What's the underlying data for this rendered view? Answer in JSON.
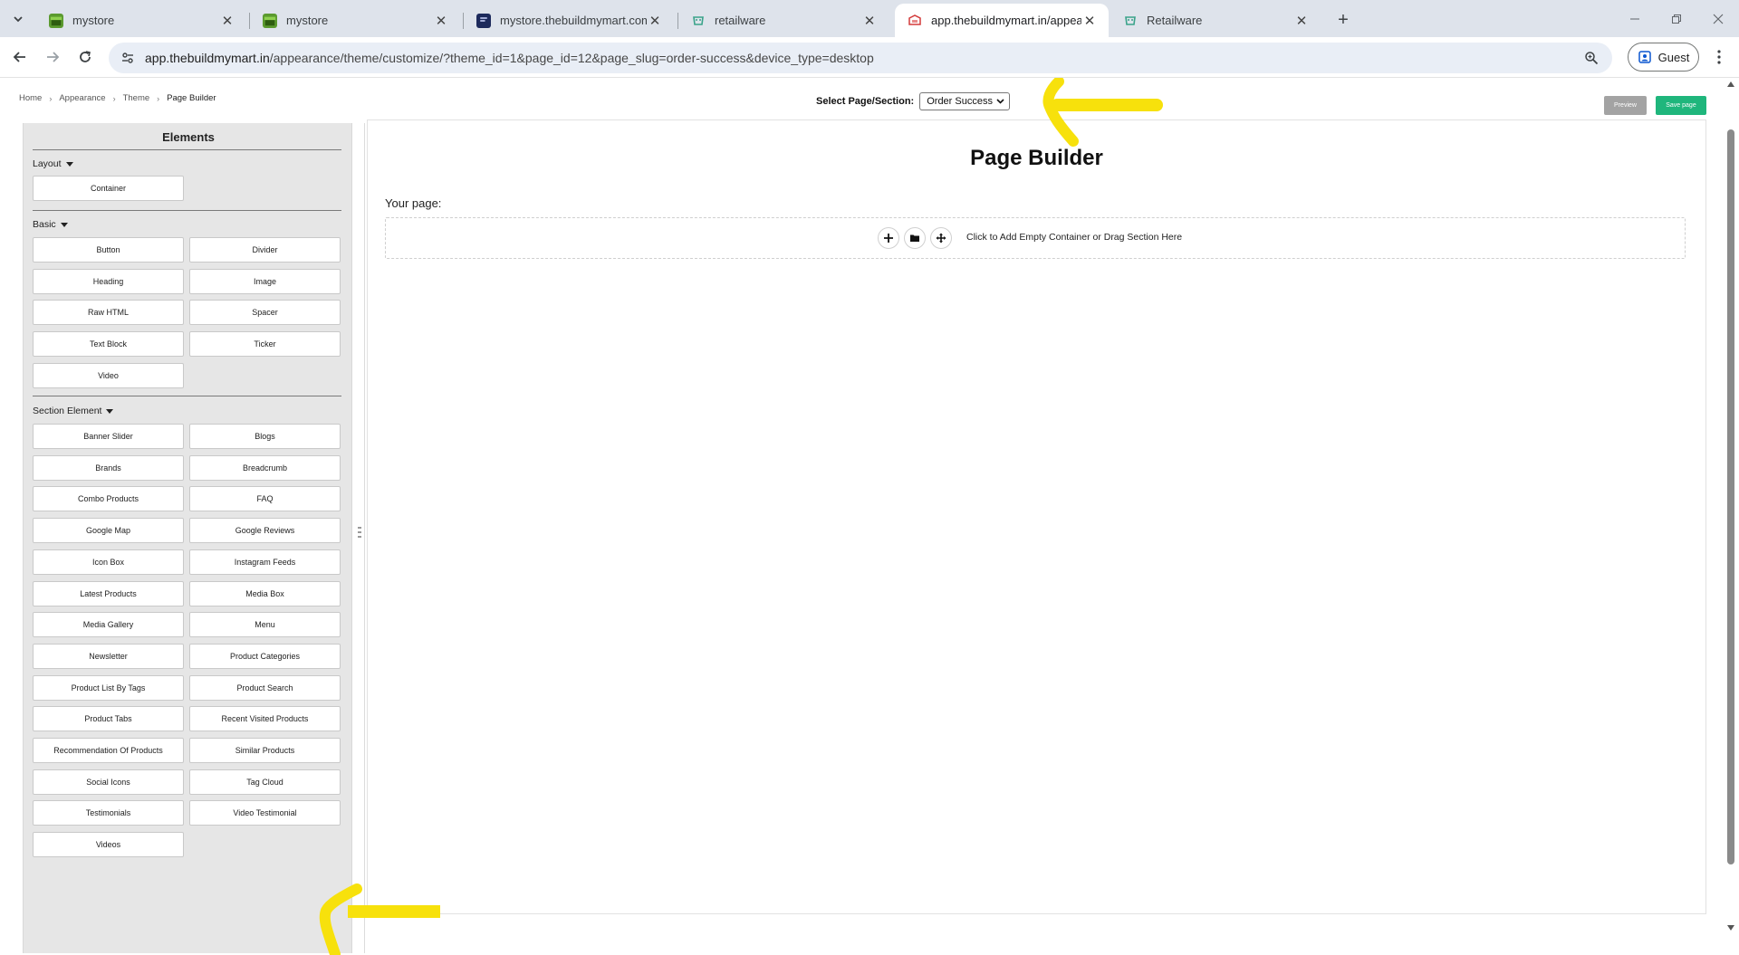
{
  "browser": {
    "tabs": [
      {
        "label": "mystore",
        "favicon": "store-green-icon",
        "active": false
      },
      {
        "label": "mystore",
        "favicon": "store-green-icon",
        "active": false
      },
      {
        "label": "mystore.thebuildmymart.com",
        "favicon": "site-navy-icon",
        "active": false
      },
      {
        "label": "retailware",
        "favicon": "retailware-icon",
        "active": false
      },
      {
        "label": "app.thebuildmymart.in/appeara",
        "favicon": "buildmymart-icon",
        "active": true
      },
      {
        "label": "Retailware",
        "favicon": "retailware-icon",
        "active": false
      }
    ],
    "address": {
      "host": "app.thebuildmymart.in",
      "path": "/appearance/theme/customize/?theme_id=1&page_id=12&page_slug=order-success&device_type=desktop"
    },
    "profile_label": "Guest",
    "colors": {
      "tabstrip": "#dee3eb",
      "omnibox": "#e9eef6"
    }
  },
  "breadcrumb": [
    "Home",
    "Appearance",
    "Theme",
    "Page Builder"
  ],
  "selector": {
    "label": "Select Page/Section:",
    "value": "Order Success"
  },
  "actions": {
    "preview_label": "Preview",
    "save_label": "Save page",
    "save_color": "#1fb67c",
    "preview_color": "#a3a3a3"
  },
  "sidebar": {
    "title": "Elements",
    "groups": {
      "layout": {
        "title": "Layout",
        "items": [
          "Container"
        ]
      },
      "basic": {
        "title": "Basic",
        "items": [
          "Button",
          "Divider",
          "Heading",
          "Image",
          "Raw HTML",
          "Spacer",
          "Text Block",
          "Ticker",
          "Video"
        ]
      },
      "section": {
        "title": "Section Element",
        "items": [
          "Banner Slider",
          "Blogs",
          "Brands",
          "Breadcrumb",
          "Combo Products",
          "FAQ",
          "Google Map",
          "Google Reviews",
          "Icon Box",
          "Instagram Feeds",
          "Latest Products",
          "Media Box",
          "Media Gallery",
          "Menu",
          "Newsletter",
          "Product Categories",
          "Product List By Tags",
          "Product Search",
          "Product Tabs",
          "Recent Visited Products",
          "Recommendation Of Products",
          "Similar Products",
          "Social Icons",
          "Tag Cloud",
          "Testimonials",
          "Video Testimonial",
          "Videos"
        ]
      }
    }
  },
  "canvas": {
    "title": "Page Builder",
    "your_page_label": "Your page:",
    "dropzone_text": "Click to Add Empty Container or Drag Section Here",
    "dropzone_icons": [
      "plus-icon",
      "folder-icon",
      "move-icon"
    ]
  },
  "annotations": {
    "color": "#f7e10c"
  }
}
